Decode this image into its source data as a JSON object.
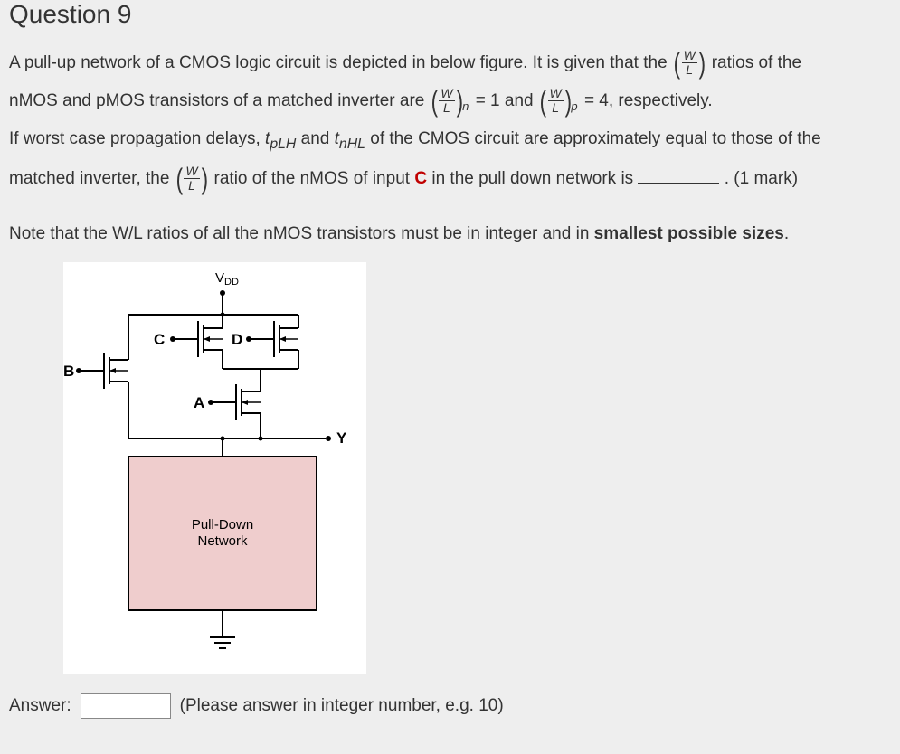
{
  "title": "Question 9",
  "para1_part1": "A pull-up network of a CMOS logic circuit is depicted in below figure. It is given that the ",
  "para1_part2": " ratios of the",
  "para2_part1": "nMOS and pMOS transistors of a matched inverter are ",
  "para2_mid1": " = 1  and  ",
  "para2_mid2": " = 4, respectively.",
  "para3_part1": "If worst case propagation delays, ",
  "t_plh": "t",
  "t_plh_sub": "pLH",
  "para3_mid": " and ",
  "t_nhl": "t",
  "t_nhl_sub": "nHL",
  "para3_part2": " of the CMOS circuit are approximately equal to those of the",
  "para4_part1": "matched inverter, the ",
  "para4_part2": " ratio of the nMOS of input ",
  "c_label": "C",
  "para4_part3": " in the pull down network is ",
  "para4_mark": " . (1 mark)",
  "note_part1": "Note that the W/L ratios of all the nMOS transistors must be in integer and in ",
  "note_bold": "smallest possible sizes",
  "note_end": ".",
  "figure": {
    "vdd": "V",
    "vdd_sub": "DD",
    "a": "A",
    "b": "B",
    "c": "C",
    "d": "D",
    "y": "Y",
    "pdn": "Pull-Down",
    "pdn2": "Network"
  },
  "answer_label": "Answer:",
  "answer_hint": "(Please answer in integer number, e.g. 10)",
  "frac_w": "W",
  "frac_l": "L",
  "sub_n": "n",
  "sub_p": "p"
}
